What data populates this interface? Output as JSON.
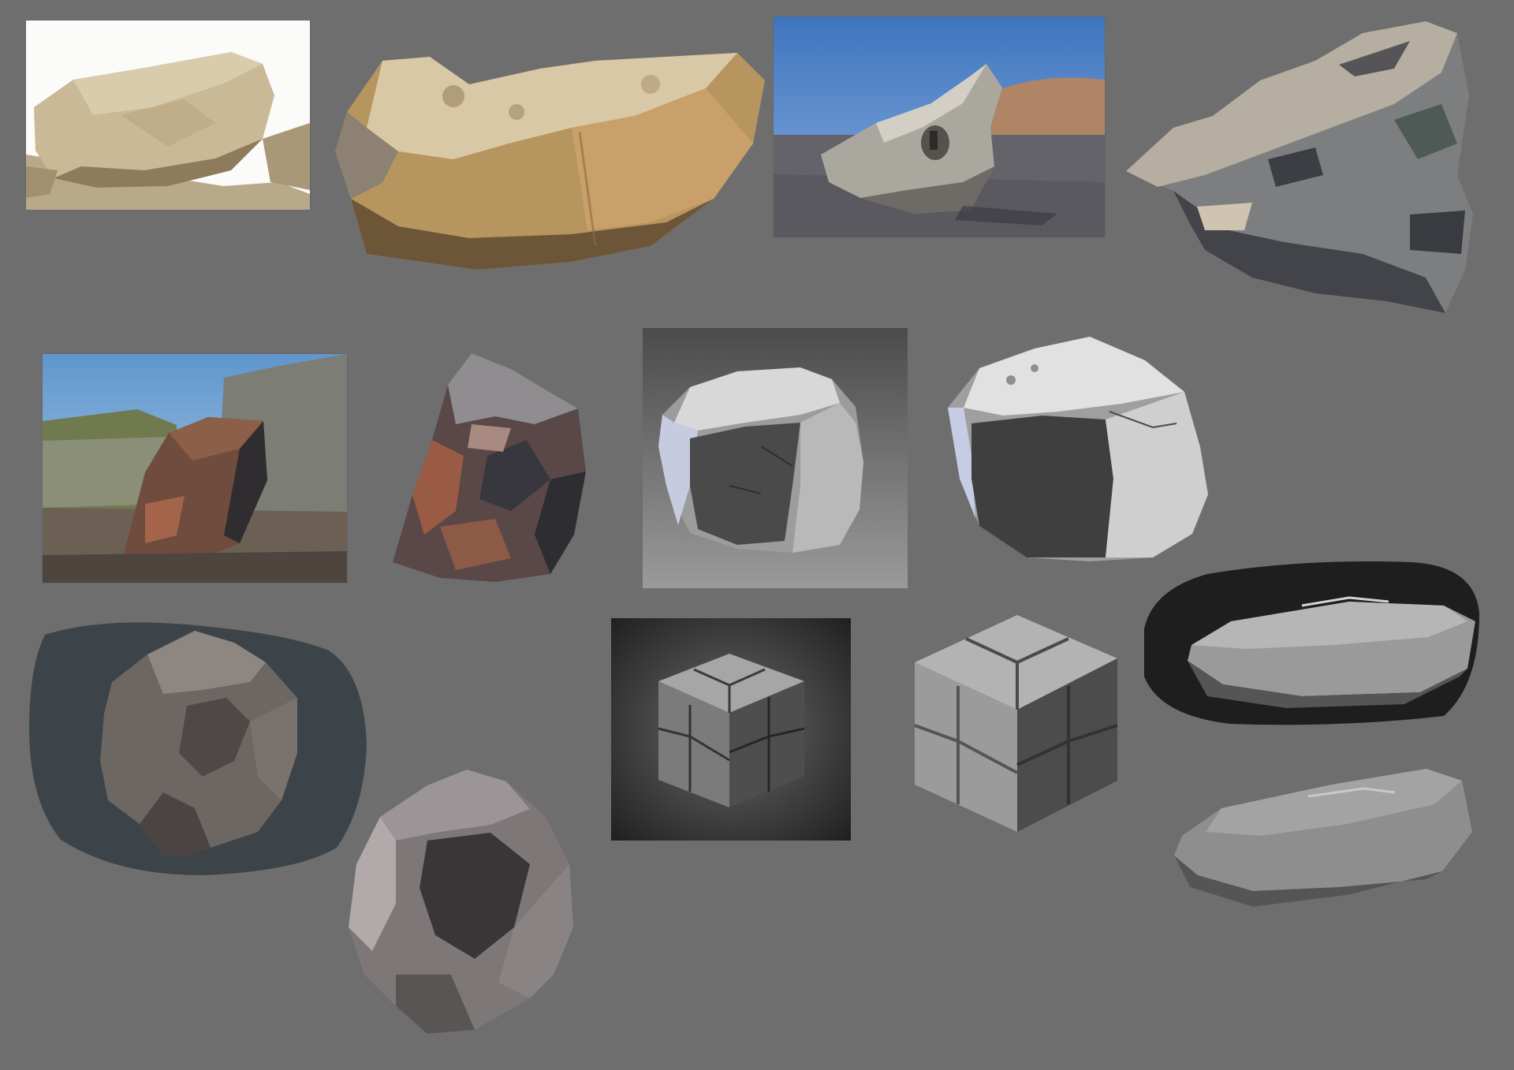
{
  "sheet": {
    "background": "#6e6e6e"
  },
  "studies": [
    {
      "id": "sand-rock-photo",
      "kind": "photo reference",
      "colors": {
        "sky": "#ffffff",
        "rock": "#c9b996",
        "shadow": "#8d7b5c"
      }
    },
    {
      "id": "sand-rock-painting",
      "kind": "painted study",
      "colors": {
        "light": "#d8c8a5",
        "mid": "#b7955f",
        "shadow": "#6d5637"
      }
    },
    {
      "id": "desert-boulder-photo",
      "kind": "photo reference",
      "colors": {
        "sky": "#4f83c7",
        "ground": "#62626a",
        "rock": "#aaa79f"
      }
    },
    {
      "id": "desert-boulder-painting",
      "kind": "painted study",
      "colors": {
        "light": "#b5aea1",
        "dark": "#43444a",
        "mid": "#7d7e80"
      }
    },
    {
      "id": "coastal-boulder-photo",
      "kind": "photo reference",
      "colors": {
        "sky": "#78a8d3",
        "cliff": "#7c7d75",
        "rock": "#6f4c3e"
      }
    },
    {
      "id": "coastal-boulder-painting",
      "kind": "painted study",
      "colors": {
        "rust": "#9a5b45",
        "dark": "#38373d",
        "light": "#8f8d90"
      }
    },
    {
      "id": "sculpted-rock-render",
      "kind": "grayscale render",
      "colors": {
        "light": "#d8d8d8",
        "dark": "#4a4a4a"
      }
    },
    {
      "id": "sculpted-rock-painting",
      "kind": "painted study",
      "colors": {
        "light": "#e1e1e1",
        "dark": "#3f3f3f"
      }
    },
    {
      "id": "faceted-rock-render",
      "kind": "3d render",
      "colors": {
        "bg": "#3c4449",
        "rock": "#6d6764"
      }
    },
    {
      "id": "faceted-rock-painting",
      "kind": "painted study",
      "colors": {
        "light": "#9c9597",
        "dark": "#393638"
      }
    },
    {
      "id": "stone-cube-render",
      "kind": "grayscale render",
      "colors": {
        "bg": "#2a2a2a",
        "light": "#a6a6a6",
        "dark": "#4e4e4e"
      }
    },
    {
      "id": "stone-cube-painting",
      "kind": "painted study",
      "colors": {
        "light": "#b3b3b3",
        "dark": "#4c4c4c"
      }
    },
    {
      "id": "flat-slab-render",
      "kind": "grayscale render",
      "colors": {
        "bg": "#1e1e1e",
        "light": "#9a9a9a",
        "dark": "#555555"
      }
    },
    {
      "id": "flat-slab-painting",
      "kind": "painted study",
      "colors": {
        "light": "#a3a3a3",
        "dark": "#555555"
      }
    }
  ]
}
